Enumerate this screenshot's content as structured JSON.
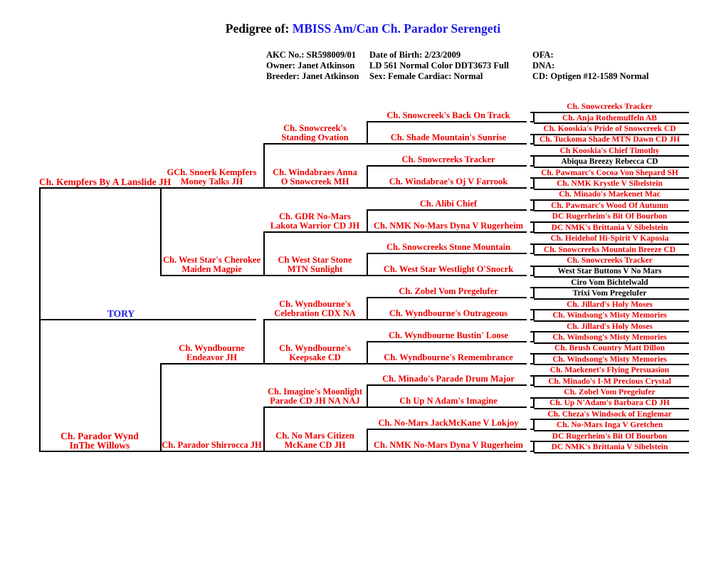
{
  "document": {
    "title_prefix": "Pedigree of:",
    "subject_name": "MBISS Am/Can Ch. Parador Serengeti",
    "title_color": "#1a1ae6",
    "name_color": "#ee0000",
    "alt_name_color": "#000000"
  },
  "meta": {
    "col1": {
      "akc": "AKC No.:  SR598009/01",
      "owner": "Owner:  Janet Atkinson",
      "breeder": "Breeder:  Janet Atkinson"
    },
    "col2": {
      "dob": "Date of Birth:  2/23/2009",
      "ld": "LD 561 Normal  Color DDT3673 Full",
      "sex": "Sex:  Female   Cardiac: Normal"
    },
    "col3": {
      "ofa": "OFA:",
      "dna": "DNA:",
      "cd": "CD: Optigen #12-1589 Normal"
    }
  },
  "tree": {
    "root": {
      "label": "TORY",
      "color": "blue"
    },
    "gen1": [
      {
        "line1": "Ch. Kempfers By A Lanslide JH",
        "line2": ""
      },
      {
        "line1": "Ch. Parador Wynd",
        "line2": "InThe Willows"
      }
    ],
    "gen2": [
      {
        "line1": "GCh.  Snoerk Kempfers",
        "line2": "Money Talks JH"
      },
      {
        "line1": "Ch. West Star's Cherokee",
        "line2": "Maiden Magpie"
      },
      {
        "line1": "Ch. Wyndbourne",
        "line2": "Endeavor JH"
      },
      {
        "line1": "Ch. Parador Shirrocca JH",
        "line2": ""
      }
    ],
    "gen3": [
      {
        "line1": "Ch. Snowcreek's",
        "line2": "Standing Ovation"
      },
      {
        "line1": "Ch. Windabraes Anna",
        "line2": "O Snowcreek MH"
      },
      {
        "line1": "Ch. GDR No-Mars",
        "line2": "Lakota Warrior CD JH"
      },
      {
        "line1": "Ch West Star Stone",
        "line2": "MTN Sunlight"
      },
      {
        "line1": "Ch. Wyndbourne's",
        "line2": "Celebration CDX NA"
      },
      {
        "line1": "Ch. Wyndbourne's",
        "line2": "Keepsake CD"
      },
      {
        "line1": "Ch. Imagine's Moonlight",
        "line2": "Parade CD JH NA NAJ"
      },
      {
        "line1": "Ch. No Mars Citizen",
        "line2": "McKane CD JH"
      }
    ],
    "gen4": [
      {
        "label": "Ch. Snowcreek's Back On Track"
      },
      {
        "label": "Ch. Shade Mountain's Sunrise"
      },
      {
        "label": "Ch. Snowcreeks Tracker"
      },
      {
        "label": "Ch. Windabrae's Oj V Farrook"
      },
      {
        "label": "Ch. Alibi Chief"
      },
      {
        "label": "Ch. NMK No-Mars Dyna V Rugerheim"
      },
      {
        "label": "Ch. Snowcreeks Stone Mountain"
      },
      {
        "label": "Ch. West Star Westlight O'Snocrk"
      },
      {
        "label": "Ch. Zobel Vom Pregelufer"
      },
      {
        "label": "Ch. Wyndbourne's Outrageous"
      },
      {
        "label": "Ch. Wyndbourne Bustin' Loose"
      },
      {
        "label": "Ch. Wyndbourne's Remembrance"
      },
      {
        "label": "Ch. Minado's Parade Drum Major"
      },
      {
        "label": "Ch Up N Adam's Imagine"
      },
      {
        "label": "Ch. No-Mars JackMcKane V Lokjoy"
      },
      {
        "label": "Ch. NMK No-Mars Dyna V Rugerheim"
      }
    ],
    "gen5": [
      {
        "label": "Ch. Snowcreeks Tracker",
        "color": "red"
      },
      {
        "label": "Ch. Anja Rothemuffeln AB",
        "color": "red"
      },
      {
        "label": "Ch. Kooskia's Pride of Snowcreek CD",
        "color": "red"
      },
      {
        "label": "Ch. Tuckoma Shade MTN Dawn CD JH",
        "color": "red"
      },
      {
        "label": "Ch Kooskia's Chief Timothy",
        "color": "red"
      },
      {
        "label": "Abiqua Breezy Rebecca CD",
        "color": "black"
      },
      {
        "label": "Ch. Pawmarc's Cocoa Von Shepard SH",
        "color": "red"
      },
      {
        "label": "Ch. NMK Krystle V Sibelstein",
        "color": "red"
      },
      {
        "label": "Ch. Minado's Maekenet Mac",
        "color": "red"
      },
      {
        "label": "Ch. Pawmarc's Wood Of Autumn",
        "color": "red"
      },
      {
        "label": "DC Rugerheim's Bit Of Bourbon",
        "color": "red"
      },
      {
        "label": "DC NMK's Brittania V Sibelstein",
        "color": "red"
      },
      {
        "label": "Ch. Heidehof Hi-Spirit V Kaposia",
        "color": "red"
      },
      {
        "label": "Ch. Snowcreeks Mountain Breeze CD",
        "color": "red"
      },
      {
        "label": "Ch. Snowcreeks Tracker",
        "color": "red"
      },
      {
        "label": "West Star Buttons V No Mars",
        "color": "black"
      },
      {
        "label": "Ciro Vom Bichtelwald",
        "color": "black"
      },
      {
        "label": "Trixi Vom Pregelufer",
        "color": "black"
      },
      {
        "label": "Ch. Jillard's Holy Moses",
        "color": "red"
      },
      {
        "label": "Ch. Windsong's Misty Memories",
        "color": "red"
      },
      {
        "label": "Ch. Jillard's Holy Moses",
        "color": "red"
      },
      {
        "label": "Ch. Windsong's Misty Memories",
        "color": "red"
      },
      {
        "label": "Ch. Brush Country Matt Dillon",
        "color": "red"
      },
      {
        "label": "Ch. Windsong's Misty Memories",
        "color": "red"
      },
      {
        "label": "Ch. Maekenet's Flying Persuasion",
        "color": "red"
      },
      {
        "label": "Ch. Minado's I-M Precious Crystal",
        "color": "red"
      },
      {
        "label": "Ch. Zobel Vom Pregelufer",
        "color": "red"
      },
      {
        "label": "Ch. Up N'Adam's Barbara CD JH",
        "color": "red"
      },
      {
        "label": "Ch. Cheza's Windsock of Englemar",
        "color": "red"
      },
      {
        "label": "Ch. No-Mars Inga V Gretchen",
        "color": "red"
      },
      {
        "label": "DC Rugerheim's Bit Of Bourbon",
        "color": "red"
      },
      {
        "label": "DC NMK's Brittania V Sibelstein",
        "color": "red"
      }
    ]
  }
}
